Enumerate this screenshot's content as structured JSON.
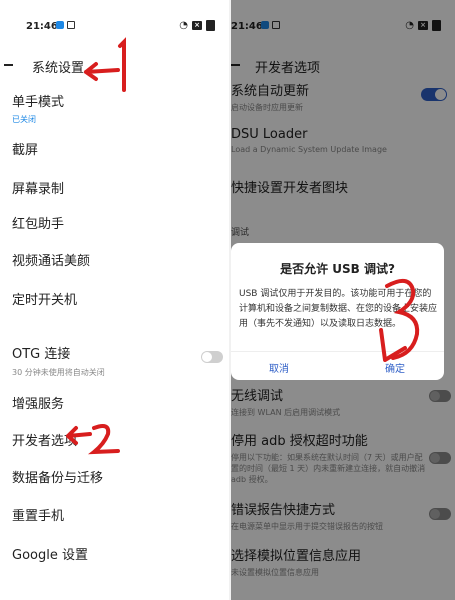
{
  "left_screen": {
    "status": {
      "time": "21:46"
    },
    "header": {
      "title": "系统设置"
    },
    "items": [
      {
        "label": "单手模式",
        "sub": "已关闭"
      },
      {
        "label": "截屏"
      },
      {
        "label": "屏幕录制"
      },
      {
        "label": "红包助手"
      },
      {
        "label": "视频通话美颜"
      },
      {
        "label": "定时开关机"
      },
      {
        "label": "OTG 连接",
        "sub": "30 分钟未使用将自动关闭"
      },
      {
        "label": "增强服务"
      },
      {
        "label": "开发者选项"
      },
      {
        "label": "数据备份与迁移"
      },
      {
        "label": "重置手机"
      },
      {
        "label": "Google 设置"
      }
    ]
  },
  "right_screen": {
    "status": {
      "time": "21:46"
    },
    "header": {
      "title": "开发者选项"
    },
    "items": [
      {
        "label": "系统自动更新",
        "sub": "启动设备时应用更新"
      },
      {
        "label": "DSU Loader",
        "sub": "Load a Dynamic System Update Image"
      },
      {
        "label": "快捷设置开发者图块"
      },
      {
        "label": "调试"
      },
      {
        "label": "无线调试",
        "sub": "连接到 WLAN 后启用调试模式"
      },
      {
        "label": "停用 adb 授权超时功能",
        "sub": "停用以下功能：如果系统在默认时间（7 天）或用户配置的时间（最短 1 天）内未重新建立连接，就自动撤消 adb 授权。"
      },
      {
        "label": "错误报告快捷方式",
        "sub": "在电源菜单中显示用于提交错误报告的按钮"
      },
      {
        "label": "选择模拟位置信息应用",
        "sub": "未设置模拟位置信息应用"
      }
    ],
    "dialog": {
      "title": "是否允许 USB 调试?",
      "body": "USB 调试仅用于开发目的。该功能可用于在您的计算机和设备之间复制数据、在您的设备上安装应用（事先不发通知）以及读取日志数据。",
      "cancel": "取消",
      "ok": "确定"
    }
  },
  "annotations": [
    "1",
    "2",
    "3"
  ],
  "colors": {
    "accent_blue": "#2f5fc7",
    "annotation_red": "#d81e1e"
  }
}
